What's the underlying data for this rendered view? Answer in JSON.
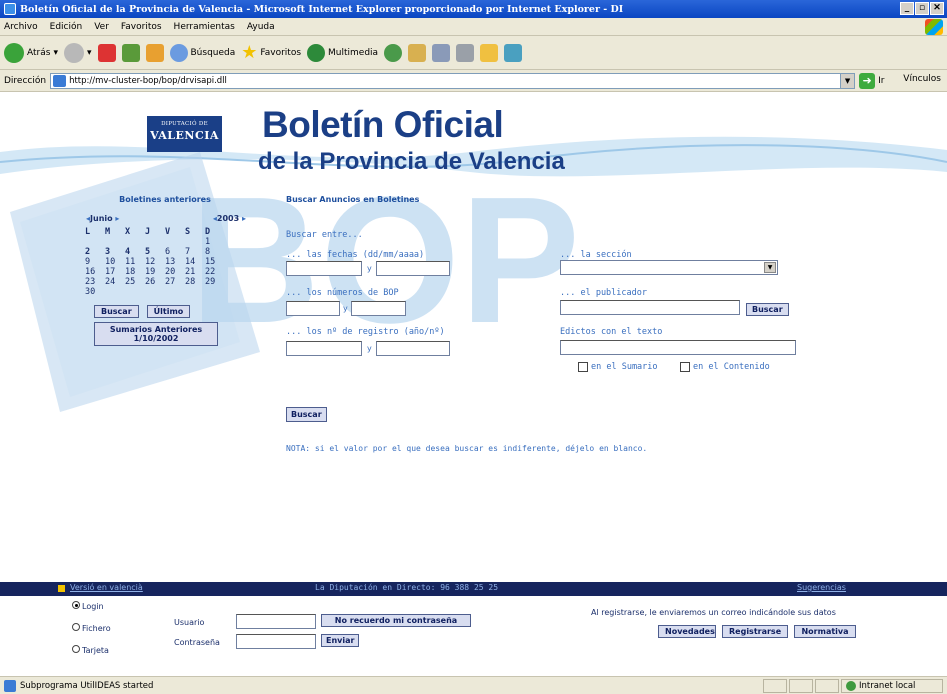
{
  "window": {
    "title": "Boletín Oficial de la Provincia de Valencia - Microsoft Internet Explorer proporcionado por Internet Explorer - DI"
  },
  "menu": [
    "Archivo",
    "Edición",
    "Ver",
    "Favoritos",
    "Herramientas",
    "Ayuda"
  ],
  "toolbar": {
    "back": "Atrás",
    "search": "Búsqueda",
    "favorites": "Favoritos",
    "multimedia": "Multimedia"
  },
  "address": {
    "label": "Dirección",
    "url": "http://mv-cluster-bop/bop/drvisapi.dll",
    "go": "Ir",
    "links": "Vínculos"
  },
  "header": {
    "logo_line1": "DIPUTACIÓ DE",
    "logo_line2": "VALENCIA",
    "title": "Boletín Oficial",
    "subtitle": "de la Provincia de Valencia"
  },
  "calendar": {
    "title": "Boletines anteriores",
    "month": "Junio",
    "year": "2003",
    "weekdays": [
      "L",
      "M",
      "X",
      "J",
      "V",
      "S",
      "D"
    ],
    "weeks": [
      [
        "",
        "",
        "",
        "",
        "",
        "",
        "1"
      ],
      [
        "2",
        "3",
        "4",
        "5",
        "6",
        "7",
        "8"
      ],
      [
        "9",
        "10",
        "11",
        "12",
        "13",
        "14",
        "15"
      ],
      [
        "16",
        "17",
        "18",
        "19",
        "20",
        "21",
        "22"
      ],
      [
        "23",
        "24",
        "25",
        "26",
        "27",
        "28",
        "29"
      ],
      [
        "30",
        "",
        "",
        "",
        "",
        "",
        ""
      ]
    ],
    "search_btn": "Buscar",
    "last_btn": "Último",
    "summaries_line1": "Sumarios Anteriores",
    "summaries_line2": "1/10/2002"
  },
  "search": {
    "title": "Buscar Anuncios en Boletines",
    "intro": "Buscar entre...",
    "dates_label": "... las fechas (dd/mm/aaaa)",
    "numbers_label": "... los números de BOP",
    "registry_label": "... los nº de registro (año/nº)",
    "section_label": "... la sección",
    "publisher_label": "... el publicador",
    "text_label": "Edictos con el texto",
    "and": "y",
    "publisher_btn": "Buscar",
    "in_summary": "en el Sumario",
    "in_content": "en el Contenido",
    "submit": "Buscar",
    "note": "NOTA: si el valor por el que desea buscar es indiferente, déjelo en blanco."
  },
  "footer": {
    "valencian": "Versió en valencià",
    "phone": "La Diputación en Directo: 96 388 25 25",
    "suggestions": "Sugerencias"
  },
  "login": {
    "radios": [
      "Login",
      "Fichero",
      "Tarjeta"
    ],
    "user_label": "Usuario",
    "password_label": "Contraseña",
    "forgot_btn": "No recuerdo mi contraseña",
    "send_btn": "Enviar",
    "register_note": "Al registrarse, le enviaremos un correo indicándole sus datos",
    "news_btn": "Novedades",
    "register_btn": "Registrarse",
    "rules_btn": "Normativa"
  },
  "status": {
    "text": "Subprograma UtilIDEAS started",
    "zone": "Intranet local"
  }
}
